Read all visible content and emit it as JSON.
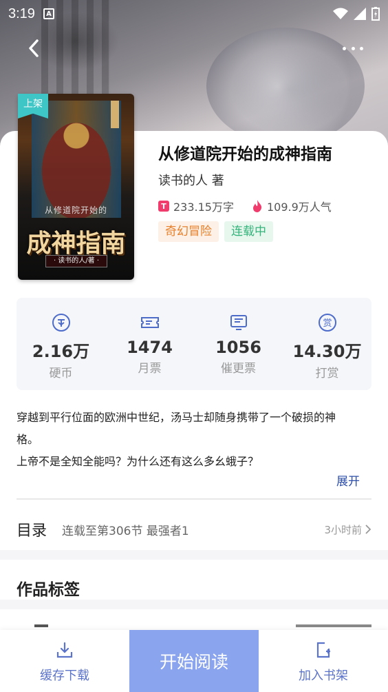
{
  "status_bar": {
    "time": "3:19",
    "notification_glyph": "A"
  },
  "book": {
    "badge": "上架",
    "title": "从修道院开始的成神指南",
    "author": "读书的人 著",
    "word_icon_letter": "T",
    "word_count": "233.15万字",
    "popularity": "109.9万人气",
    "tags": [
      "奇幻冒险",
      "连载中"
    ],
    "cover_title": "成神指南",
    "cover_subtitle": "从修道院开始的",
    "cover_author": "· 读书的人/著 ·"
  },
  "stats": [
    {
      "icon": "coin-icon",
      "value": "2.16万",
      "label": "硬币"
    },
    {
      "icon": "ticket-icon",
      "value": "1474",
      "label": "月票"
    },
    {
      "icon": "urge-update-icon",
      "value": "1056",
      "label": "催更票"
    },
    {
      "icon": "reward-icon",
      "value": "14.30万",
      "label": "打赏"
    }
  ],
  "synopsis": {
    "line1": "穿越到平行位面的欧洲中世纪，汤马士却随身携带了一个破损的神",
    "line2": "格。",
    "line3": "上帝不是全知全能吗？为什么还有这么多幺蛾子？",
    "expand": "展开"
  },
  "toc": {
    "label": "目录",
    "latest": "连载至第306节 最强者1",
    "time": "3小时前"
  },
  "tags_section": {
    "title": "作品标签"
  },
  "bottom_bar": {
    "download": "缓存下载",
    "read": "开始阅读",
    "add_shelf": "加入书架"
  },
  "colors": {
    "accent": "#8ba4ee",
    "link": "#2d4ea8",
    "genre_tag": "#e77f2a",
    "status_tag": "#34b37a"
  }
}
